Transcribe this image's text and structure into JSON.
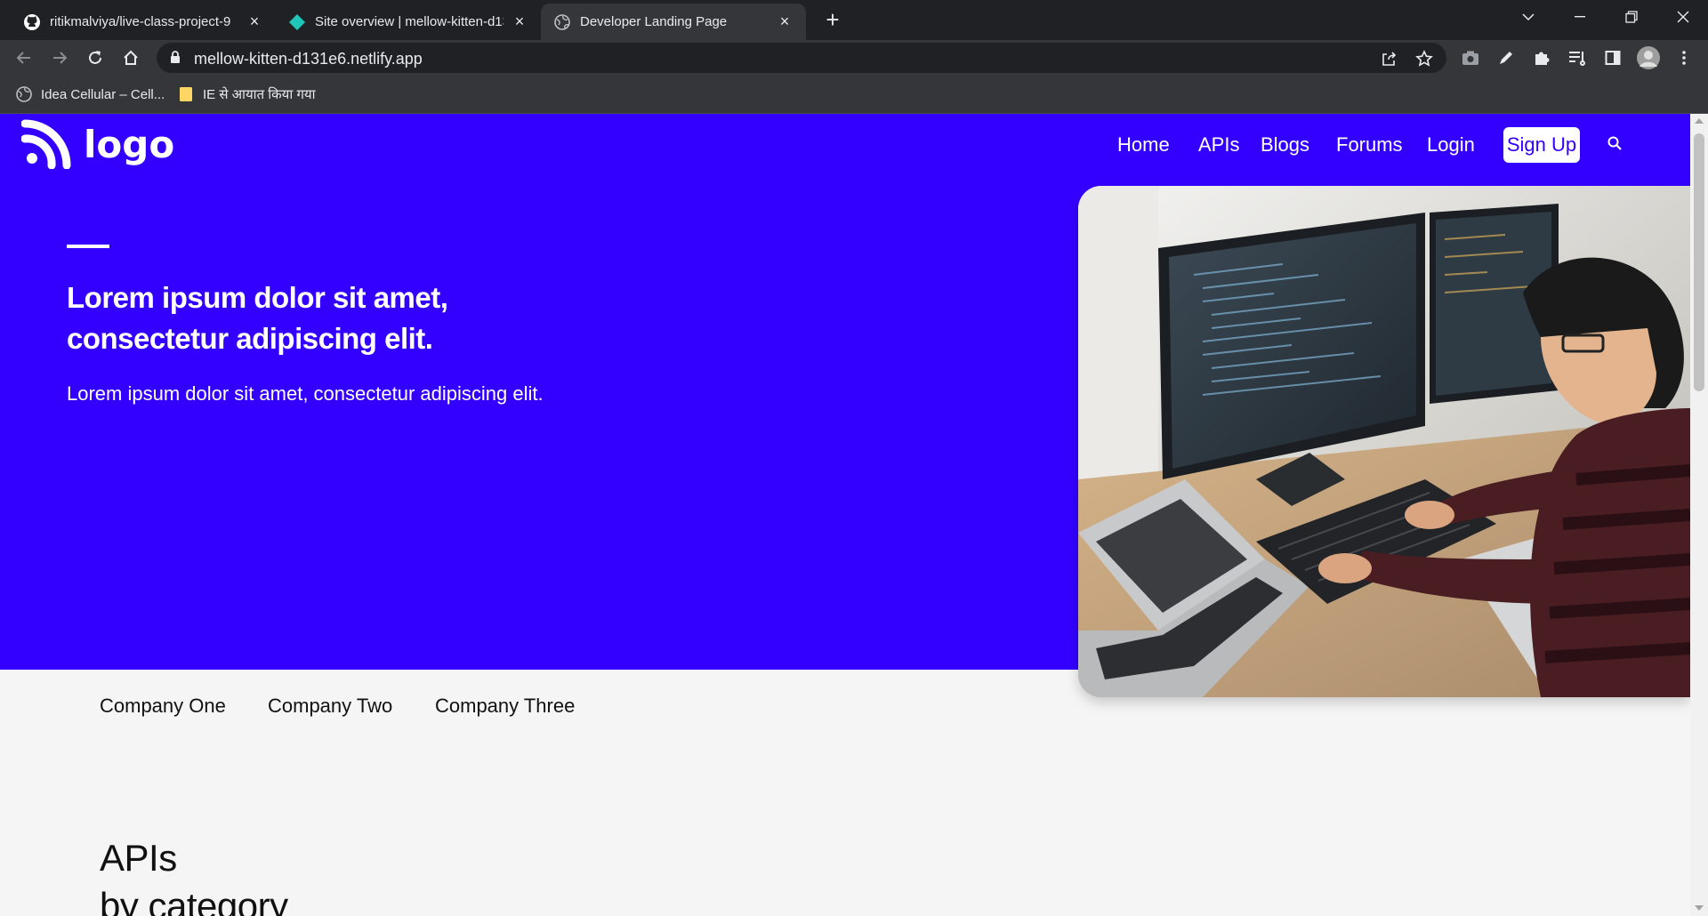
{
  "browser": {
    "tabs": [
      {
        "title": "ritikmalviya/live-class-project-9",
        "icon": "github-icon"
      },
      {
        "title": "Site overview | mellow-kitten-d131e6",
        "icon": "netlify-icon"
      },
      {
        "title": "Developer Landing Page",
        "icon": "globe-icon",
        "active": true
      }
    ],
    "url": "mellow-kitten-d131e6.netlify.app",
    "bookmarks": [
      {
        "label": "Idea Cellular – Cell...",
        "icon": "globe-icon"
      },
      {
        "label": "IE से आयात किया गया",
        "icon": "folder-icon"
      }
    ]
  },
  "site": {
    "logo_text": "logo",
    "nav": {
      "home": "Home",
      "apis": "APIs",
      "blogs": "Blogs",
      "forums": "Forums",
      "login": "Login",
      "signup": "Sign Up"
    },
    "hero": {
      "title": "Lorem ipsum dolor sit amet, consectetur adipiscing elit.",
      "subtitle": "Lorem ipsum dolor sit amet, consectetur adipiscing elit.",
      "image_alt": "developer-at-computer-photo"
    },
    "companies": [
      "Company One",
      "Company Two",
      "Company Three"
    ],
    "apis_section": {
      "title": "APIs",
      "subtitle": "by category"
    },
    "colors": {
      "brand": "#3300ff",
      "page_bg": "#f5f5f5"
    }
  }
}
